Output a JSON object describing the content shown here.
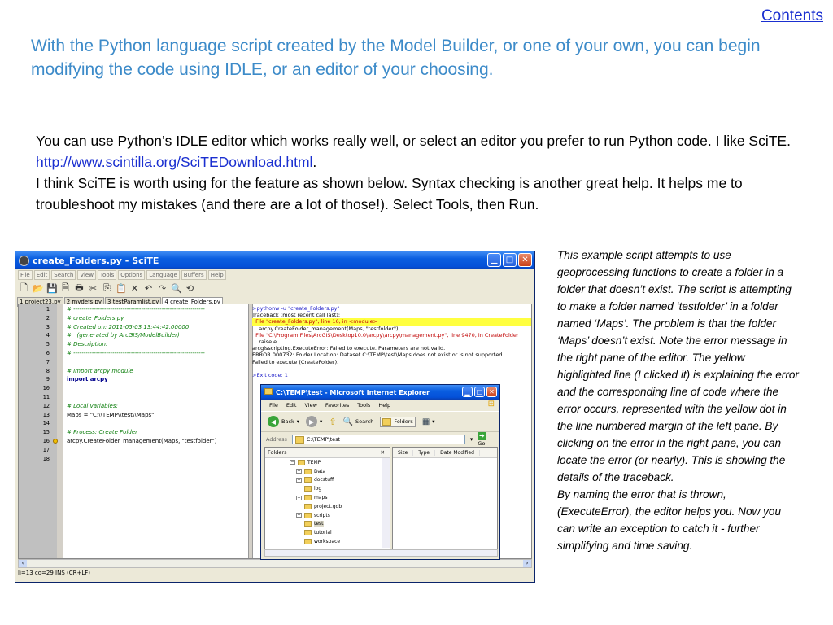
{
  "contents_link": "Contents",
  "headline": "With the Python language script created by the Model Builder, or one of your own, you can begin modifying the code using IDLE, or an editor of your choosing.",
  "body": {
    "p1_a": "You can use Python’s IDLE editor which works really well, or select an editor you prefer to run Python code. I like SciTE. ",
    "link": "http://www.scintilla.org/SciTEDownload.html",
    "p1_b": ".",
    "p2": "I think SciTE is worth using for the feature as shown below. Syntax checking is another great help. It helps me to troubleshoot my mistakes (and there are a lot of those!). Select Tools, then Run."
  },
  "side_note": {
    "p1": "This example script attempts to use geoprocessing functions to create a folder in a folder that doesn’t exist. The script is attempting to make a folder named ‘testfolder’ in a folder named ‘Maps’. The problem is that the folder ‘Maps’ doesn’t exist. Note the error message in the right pane of the editor. The yellow highlighted line (I clicked it) is explaining the error and the corresponding line of code where the error occurs, represented with the yellow dot in the line numbered margin of the left pane. By clicking on the error in the right pane, you can locate the error (or nearly). This is showing the details of the traceback.",
    "p2": "By naming the error that is thrown, (ExecuteError), the editor helps you. Now you can write an exception to catch it - further simplifying and time saving."
  },
  "scite": {
    "title": "create_Folders.py - SciTE",
    "menu": [
      "File",
      "Edit",
      "Search",
      "View",
      "Tools",
      "Options",
      "Language",
      "Buffers",
      "Help"
    ],
    "tabs": [
      "1 project23.py",
      "2 mydefs.py",
      "3 testParamlist.py",
      "4 create_Folders.py"
    ],
    "code_lines": [
      {
        "n": "1",
        "text": "# ----------------------------------------------------------------",
        "style": "comment"
      },
      {
        "n": "2",
        "text": "# create_Folders.py",
        "style": "comment"
      },
      {
        "n": "3",
        "text": "# Created on: 2011-05-03 13:44:42.00000",
        "style": "comment"
      },
      {
        "n": "4",
        "text": "#   (generated by ArcGIS/ModelBuilder)",
        "style": "comment"
      },
      {
        "n": "5",
        "text": "# Description:",
        "style": "comment"
      },
      {
        "n": "6",
        "text": "# ----------------------------------------------------------------",
        "style": "comment"
      },
      {
        "n": "7",
        "text": "",
        "style": "plain"
      },
      {
        "n": "8",
        "text": "# Import arcpy module",
        "style": "comment"
      },
      {
        "n": "9",
        "text": "import arcpy",
        "style": "kw"
      },
      {
        "n": "10",
        "text": "",
        "style": "plain"
      },
      {
        "n": "11",
        "text": "",
        "style": "plain"
      },
      {
        "n": "12",
        "text": "# Local variables:",
        "style": "comment"
      },
      {
        "n": "13",
        "text": "Maps = \"C:\\\\TEMP\\\\test\\\\Maps\"",
        "style": "plain"
      },
      {
        "n": "14",
        "text": "",
        "style": "plain"
      },
      {
        "n": "15",
        "text": "# Process: Create Folder",
        "style": "comment"
      },
      {
        "n": "16",
        "text": "arcpy.CreateFolder_management(Maps, \"testfolder\")",
        "style": "plain",
        "marker": true
      },
      {
        "n": "17",
        "text": "",
        "style": "plain"
      },
      {
        "n": "18",
        "text": "",
        "style": "plain"
      }
    ],
    "output_lines": [
      {
        "text": ">pythonw -u \"create_Folders.py\"",
        "style": "blue"
      },
      {
        "text": "Traceback (most recent call last):",
        "style": "plain"
      },
      {
        "text": "  File \"create_Folders.py\", line 16, in <module>",
        "style": "hl"
      },
      {
        "text": "    arcpy.CreateFolder_management(Maps, \"testfolder\")",
        "style": "plain"
      },
      {
        "text": "  File \"C:\\Program Files\\ArcGIS\\Desktop10.0\\arcpy\\arcpy\\management.py\", line 9470, in CreateFolder",
        "style": "err"
      },
      {
        "text": "    raise e",
        "style": "plain"
      },
      {
        "text": "arcgisscripting.ExecuteError: Failed to execute. Parameters are not valid.",
        "style": "plain"
      },
      {
        "text": "ERROR 000732: Folder Location: Dataset C:\\TEMP\\test\\Maps does not exist or is not supported",
        "style": "plain"
      },
      {
        "text": "Failed to execute (CreateFolder).",
        "style": "plain"
      },
      {
        "text": "",
        "style": "plain"
      },
      {
        "text": ">Exit code: 1",
        "style": "blue"
      }
    ],
    "status": "li=13 co=29 INS (CR+LF)"
  },
  "ie": {
    "title": "C:\\TEMP\\test - Microsoft Internet Explorer",
    "menu": [
      "File",
      "Edit",
      "View",
      "Favorites",
      "Tools",
      "Help"
    ],
    "back": "Back",
    "search": "Search",
    "folders": "Folders",
    "address_label": "Address",
    "address": "C:\\TEMP\\test",
    "go": "Go",
    "folders_pane_title": "Folders",
    "tree": [
      {
        "label": "TEMP",
        "indent": 1,
        "expand": "−"
      },
      {
        "label": "Data",
        "indent": 2,
        "expand": "+"
      },
      {
        "label": "docstuff",
        "indent": 2,
        "expand": "+"
      },
      {
        "label": "log",
        "indent": 2,
        "expand": ""
      },
      {
        "label": "maps",
        "indent": 2,
        "expand": "+"
      },
      {
        "label": "project.gdb",
        "indent": 2,
        "expand": ""
      },
      {
        "label": "scripts",
        "indent": 2,
        "expand": "+"
      },
      {
        "label": "test",
        "indent": 2,
        "expand": "",
        "selected": true
      },
      {
        "label": "tutorial",
        "indent": 2,
        "expand": ""
      },
      {
        "label": "workspace",
        "indent": 2,
        "expand": ""
      }
    ],
    "columns": [
      "Size",
      "Type",
      "Date Modified"
    ]
  },
  "icons": {
    "window_buttons": [
      "minimize-icon",
      "maximize-icon",
      "close-icon"
    ],
    "folder": "folder-icon"
  }
}
